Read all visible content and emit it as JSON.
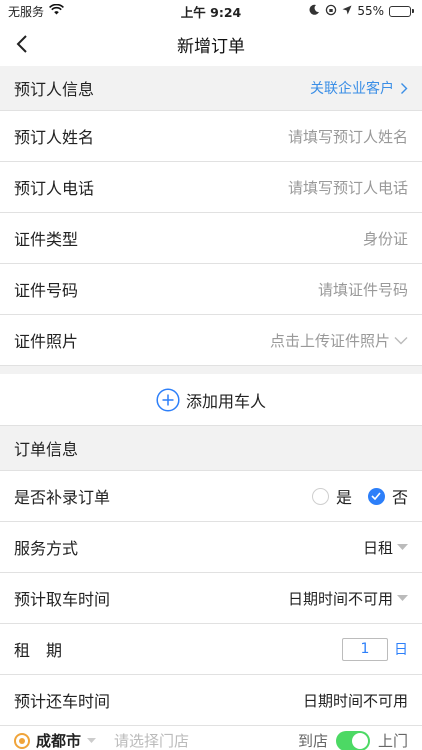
{
  "status": {
    "carrier": "无服务",
    "time": "上午 9:24",
    "battery": "55%",
    "battery_level": 0.55
  },
  "nav": {
    "title": "新增订单"
  },
  "booker": {
    "header": "预订人信息",
    "link": "关联企业客户",
    "rows": [
      {
        "label": "预订人姓名",
        "value": "请填写预订人姓名"
      },
      {
        "label": "预订人电话",
        "value": "请填写预订人电话"
      },
      {
        "label": "证件类型",
        "value": "身份证"
      },
      {
        "label": "证件号码",
        "value": "请填证件号码"
      },
      {
        "label": "证件照片",
        "value": "点击上传证件照片"
      }
    ]
  },
  "add_driver": {
    "label": "添加用车人"
  },
  "order": {
    "header": "订单信息",
    "supplement": {
      "label": "是否补录订单",
      "yes": "是",
      "no": "否",
      "selected": "否"
    },
    "service": {
      "label": "服务方式",
      "value": "日租"
    },
    "pickup": {
      "label": "预计取车时间",
      "value": "日期时间不可用"
    },
    "rental": {
      "label": "租　期",
      "value": "1",
      "unit": "日"
    },
    "return": {
      "label": "预计还车时间",
      "value": "日期时间不可用"
    }
  },
  "bottom": {
    "city": "成都市",
    "store_placeholder": "请选择门店",
    "mode_left": "到店",
    "mode_right": "上门"
  }
}
